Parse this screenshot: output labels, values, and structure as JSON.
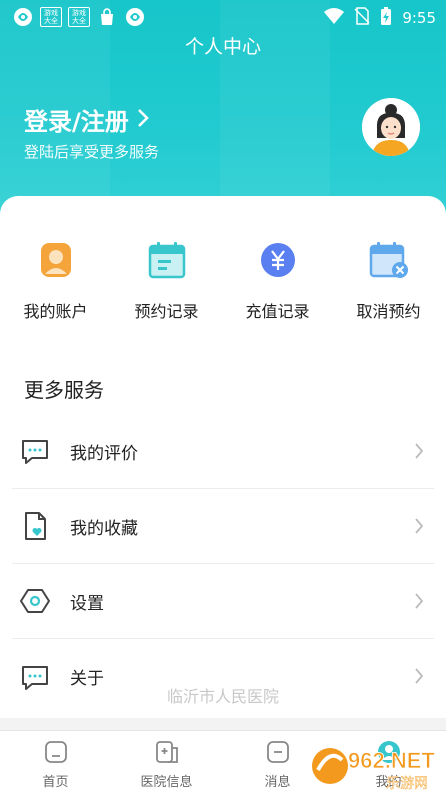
{
  "status_bar": {
    "time": "9:55",
    "app_icons": [
      "app-swirl-icon",
      "game-badge-icon",
      "game-badge-icon",
      "bag-icon",
      "app-swirl-icon"
    ],
    "badge_text": "游戏大全",
    "right_icons": [
      "wifi-icon",
      "no-sim-icon",
      "battery-charging-icon"
    ]
  },
  "header": {
    "title": "个人中心",
    "login_title": "登录/注册",
    "login_subtitle": "登陆后享受更多服务"
  },
  "quick_actions": [
    {
      "label": "我的账户",
      "icon": "account-icon"
    },
    {
      "label": "预约记录",
      "icon": "calendar-icon"
    },
    {
      "label": "充值记录",
      "icon": "yuan-coin-icon"
    },
    {
      "label": "取消预约",
      "icon": "calendar-cancel-icon"
    }
  ],
  "more_services": {
    "title": "更多服务",
    "items": [
      {
        "label": "我的评价",
        "icon": "comment-icon"
      },
      {
        "label": "我的收藏",
        "icon": "favorite-doc-icon"
      },
      {
        "label": "设置",
        "icon": "settings-hex-icon"
      },
      {
        "label": "关于",
        "icon": "about-icon"
      }
    ]
  },
  "watermark": "临沂市人民医院",
  "tabbar": {
    "tabs": [
      {
        "label": "首页",
        "icon": "home-icon"
      },
      {
        "label": "医院信息",
        "icon": "hospital-icon"
      },
      {
        "label": "消息",
        "icon": "message-icon"
      },
      {
        "label": "我的",
        "icon": "profile-icon"
      }
    ]
  },
  "overlay_logo": {
    "text": "962.NET",
    "sub": "乐游网"
  },
  "colors": {
    "header": "#1fc9cd",
    "accent_teal": "#36c6cc",
    "account_orange": "#f4a43a",
    "coin_blue": "#5a7ff0"
  }
}
